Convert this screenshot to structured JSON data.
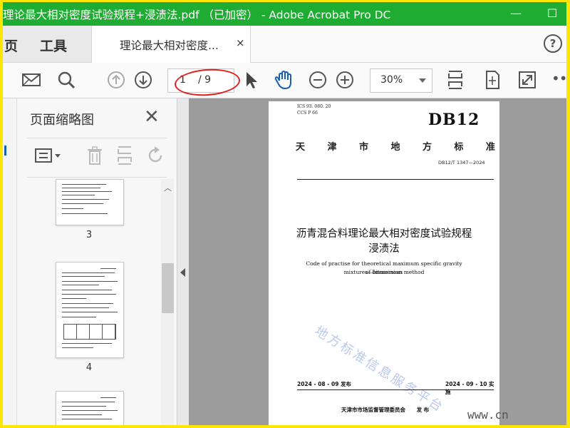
{
  "window": {
    "title": "理论最大相对密度试验规程+浸渍法.pdf （已加密） - Adobe Acrobat Pro DC",
    "minimize_label": "—",
    "maximize_label": "☐",
    "accent_color": "#1ead32",
    "frame_color": "#ffe600"
  },
  "nav": {
    "home_tab": "页",
    "tools_tab": "工具",
    "help_label": "?"
  },
  "doc_tab": {
    "label": "理论最大相对密度...",
    "close": "×"
  },
  "toolbar": {
    "current_page": "1",
    "total_pages": "/ 9",
    "zoom": "30%",
    "more": "•••",
    "icons": [
      "mail-icon",
      "search-icon",
      "prev-page-icon",
      "next-page-icon",
      "select-arrow-icon",
      "hand-icon",
      "zoom-out-icon",
      "zoom-in-icon",
      "fit-page-icon",
      "rotate-view-icon",
      "fullscreen-icon"
    ]
  },
  "thumbnails_panel": {
    "title": "页面缩略图",
    "close": "✕",
    "pages": [
      {
        "number": "3"
      },
      {
        "number": "4"
      },
      {
        "number": ""
      }
    ]
  },
  "document": {
    "ics": "ICS  93. 080. 20",
    "ccs": "CCS  P  66",
    "db_code": "DB12",
    "region": [
      "天",
      "津",
      "市",
      "地",
      "方",
      "标",
      "准"
    ],
    "std_number": "DB12/T 1347—2024",
    "title_cn_line1": "沥青混合料理论最大相对密度试验规程",
    "title_cn_line2": "浸渍法",
    "title_en_line1": "Code of practise for theoretical maximum specific gravity of bituminous",
    "title_en_line2": "mixtures—Immersion method",
    "watermark": "地方标准信息服务平台",
    "issue_date": "2024 - 08 - 09 发布",
    "effective_date": "2024 - 09 - 10 实施",
    "issuer": "天津市市场监督管理委员会      发 布"
  },
  "site_ref": "www.cn"
}
